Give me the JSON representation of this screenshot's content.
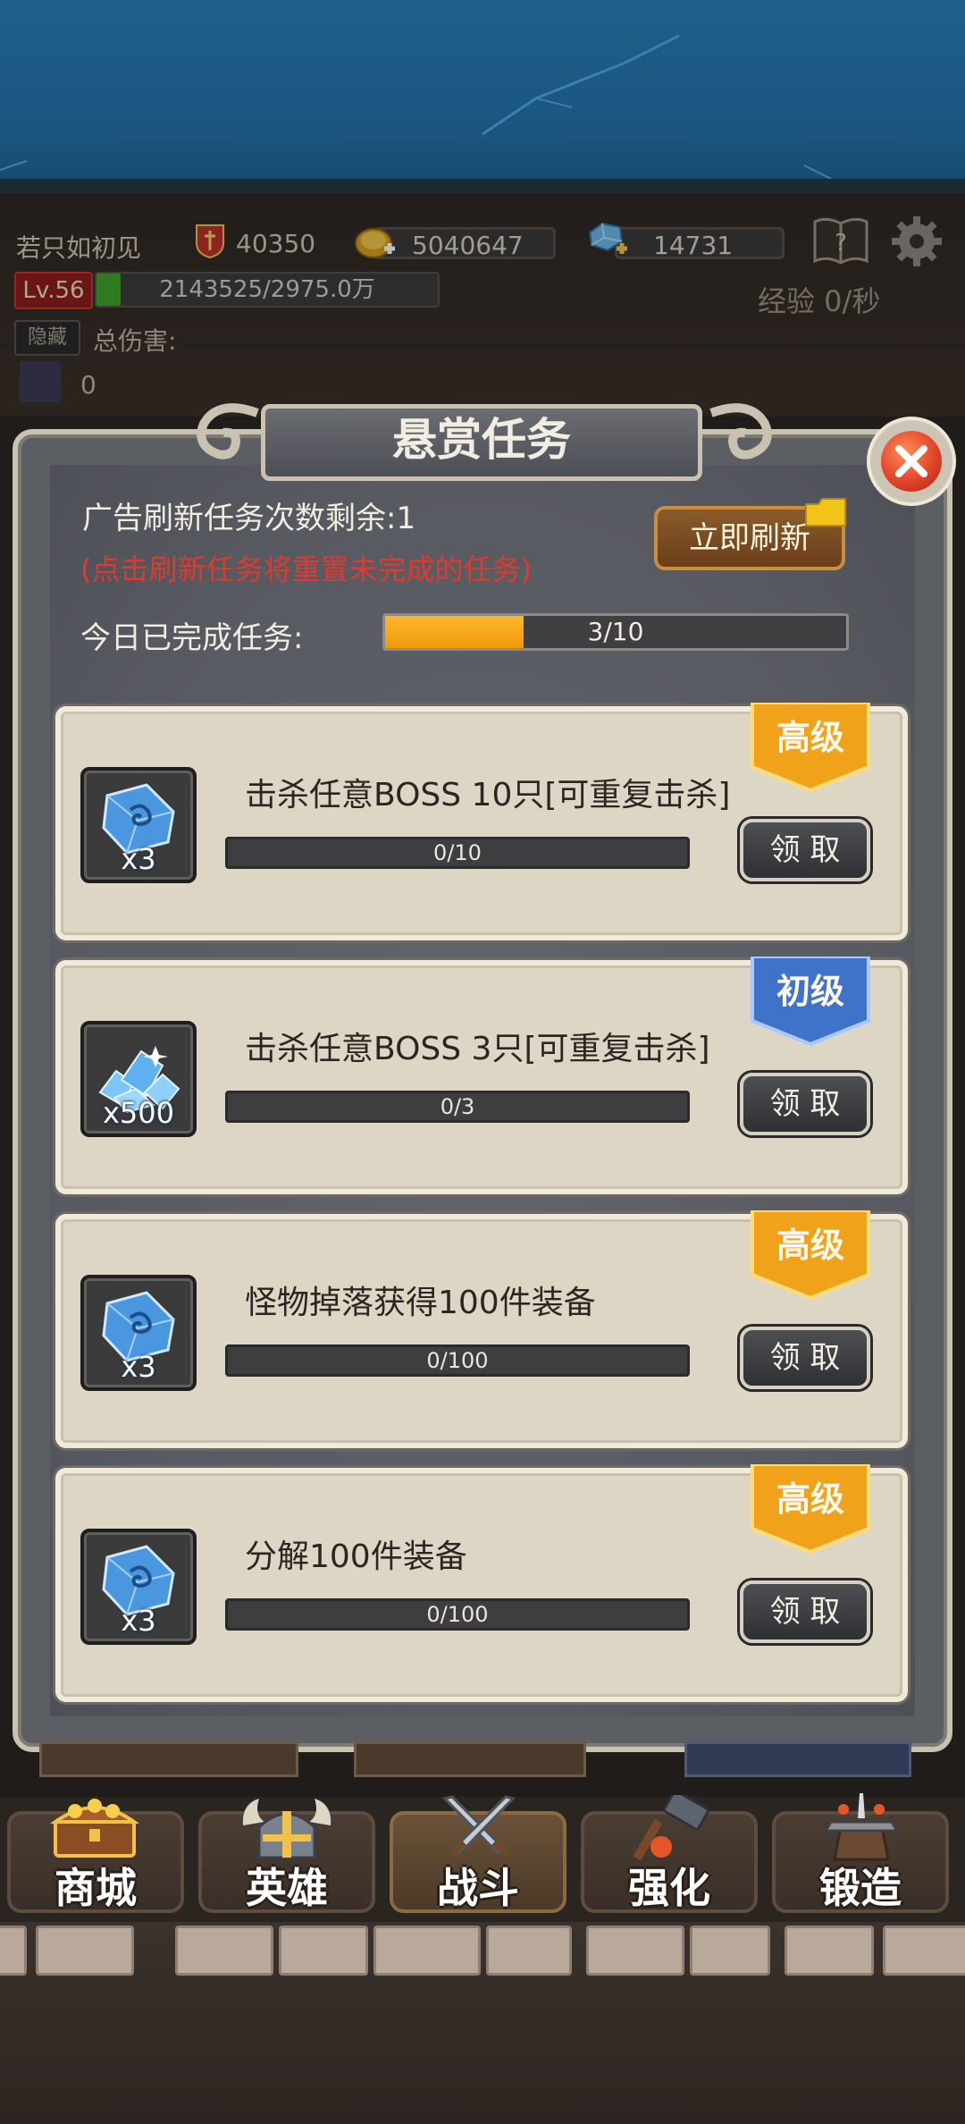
{
  "player": {
    "name": "若只如初见",
    "power": "40350",
    "gold": "5040647",
    "gems": "14731",
    "level": "Lv.56",
    "exp_text": "2143525/2975.0万",
    "exp_fraction": 0.07,
    "exp_rate": "经验 0/秒",
    "hide_label": "隐藏",
    "total_damage_label": "总伤害:",
    "pet_value": "0"
  },
  "modal": {
    "title": "悬赏任务",
    "refresh_remaining": "广告刷新任务次数剩余:1",
    "refresh_warning": "(点击刷新任务将重置未完成的任务)",
    "refresh_button": "立即刷新",
    "completed_label": "今日已完成任务:",
    "completed_progress": "3/10",
    "completed_fraction": 0.3
  },
  "tasks": [
    {
      "tier": "高级",
      "tier_color": "#f0a21a",
      "title": "击杀任意BOSS 10只[可重复击杀]",
      "progress": "0/10",
      "reward_icon": "skill-scroll-crystal-icon",
      "reward_qty": "x3",
      "claim_label": "领 取"
    },
    {
      "tier": "初级",
      "tier_color": "#3f73c9",
      "title": "击杀任意BOSS 3只[可重复击杀]",
      "progress": "0/3",
      "reward_icon": "diamond-pile-icon",
      "reward_qty": "x500",
      "claim_label": "领 取"
    },
    {
      "tier": "高级",
      "tier_color": "#f0a21a",
      "title": "怪物掉落获得100件装备",
      "progress": "0/100",
      "reward_icon": "skill-scroll-crystal-icon",
      "reward_qty": "x3",
      "claim_label": "领 取"
    },
    {
      "tier": "高级",
      "tier_color": "#f0a21a",
      "title": "分解100件装备",
      "progress": "0/100",
      "reward_icon": "skill-scroll-crystal-icon",
      "reward_qty": "x3",
      "claim_label": "领 取"
    }
  ],
  "nav": [
    {
      "label": "商城",
      "icon": "treasure-chest-icon"
    },
    {
      "label": "英雄",
      "icon": "viking-helmet-icon"
    },
    {
      "label": "战斗",
      "icon": "crossed-swords-icon",
      "active": true
    },
    {
      "label": "强化",
      "icon": "hammer-icon"
    },
    {
      "label": "锻造",
      "icon": "forge-icon"
    }
  ],
  "colors": {
    "accent_gold": "#f0a21a",
    "warning_red": "#e03a2f",
    "exp_green": "#3fa22b",
    "tier_blue": "#3f73c9"
  }
}
